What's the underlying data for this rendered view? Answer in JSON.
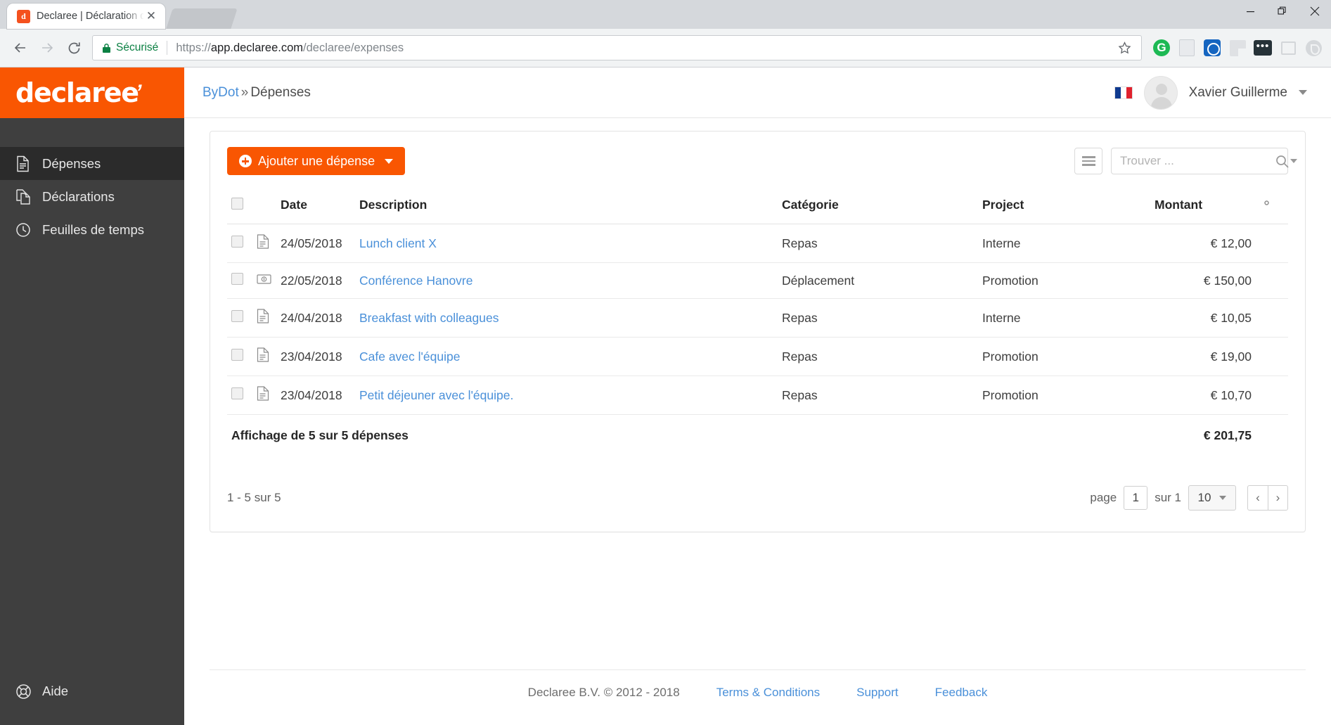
{
  "browser": {
    "tab": {
      "title": "Declaree | Déclaration de",
      "favicon_label": "d",
      "close_icon": "close-icon"
    },
    "secure_label": "Sécurisé",
    "url": {
      "scheme": "https://",
      "host": "app.declaree.com",
      "path": "/declaree/expenses"
    },
    "window_controls": {
      "minimize": "minimize-icon",
      "restore": "restore-icon",
      "close": "close-icon"
    },
    "extensions": [
      "grammarly-icon",
      "document-edit-icon",
      "compass-icon",
      "window-split-icon",
      "ellipsis-icon",
      "keyboard-icon",
      "clock-phone-icon"
    ]
  },
  "brand": {
    "name": "declaree",
    "mark": "’",
    "color": "#f95602"
  },
  "sidebar": {
    "items": [
      {
        "label": "Dépenses",
        "icon": "document-icon",
        "active": true
      },
      {
        "label": "Déclarations",
        "icon": "documents-copy-icon",
        "active": false
      },
      {
        "label": "Feuilles de temps",
        "icon": "clock-icon",
        "active": false
      }
    ],
    "help": {
      "label": "Aide",
      "icon": "life-ring-icon"
    }
  },
  "topbar": {
    "breadcrumb": {
      "root": "ByDot",
      "separator": "»",
      "current": "Dépenses"
    },
    "language_flag": "france-flag-icon",
    "user": {
      "name": "Xavier Guillerme",
      "avatar": "avatar-placeholder-icon"
    }
  },
  "toolbar": {
    "add_expense_label": "Ajouter une dépense",
    "add_icon": "plus-circle-icon",
    "list_view_icon": "hamburger-icon",
    "search": {
      "placeholder": "Trouver ...",
      "value": "",
      "icon": "search-icon"
    }
  },
  "table": {
    "columns": [
      "Date",
      "Description",
      "Catégorie",
      "Project",
      "Montant"
    ],
    "settings_icon": "gear-icon",
    "rows": [
      {
        "icon": "document-icon",
        "date": "24/05/2018",
        "description": "Lunch client X",
        "category": "Repas",
        "project": "Interne",
        "amount": "€ 12,00"
      },
      {
        "icon": "banknote-icon",
        "date": "22/05/2018",
        "description": "Conférence Hanovre",
        "category": "Déplacement",
        "project": "Promotion",
        "amount": "€ 150,00"
      },
      {
        "icon": "document-icon",
        "date": "24/04/2018",
        "description": "Breakfast with colleagues",
        "category": "Repas",
        "project": "Interne",
        "amount": "€ 10,05"
      },
      {
        "icon": "document-icon",
        "date": "23/04/2018",
        "description": "Cafe avec l'équipe",
        "category": "Repas",
        "project": "Promotion",
        "amount": "€ 19,00"
      },
      {
        "icon": "document-icon",
        "date": "23/04/2018",
        "description": "Petit déjeuner avec l'équipe.",
        "category": "Repas",
        "project": "Promotion",
        "amount": "€ 10,70"
      }
    ],
    "summary_label": "Affichage de 5 sur 5 dépenses",
    "summary_amount": "€ 201,75"
  },
  "pagination": {
    "range_label": "1 - 5 sur 5",
    "page_word": "page",
    "page_value": "1",
    "of_label": "sur 1",
    "page_size": "10",
    "prev": "‹",
    "next": "›"
  },
  "footer": {
    "copyright": "Declaree B.V. © 2012 - 2018",
    "links": [
      "Terms & Conditions",
      "Support",
      "Feedback"
    ]
  }
}
